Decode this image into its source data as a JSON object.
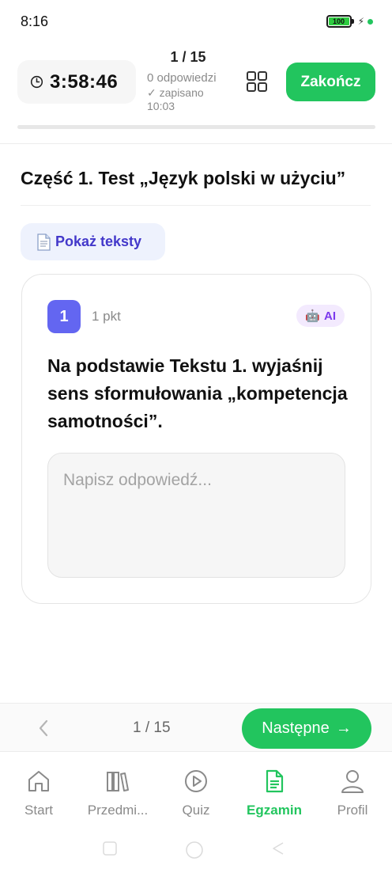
{
  "status_bar": {
    "time": "8:16",
    "battery_text": "100",
    "battery_level": 1.0
  },
  "header": {
    "timer": "3:58:46",
    "progress": "1 / 15",
    "answers": "0 odpowiedzi",
    "saved": "✓ zapisano",
    "saved_time": "10:03",
    "finish_label": "Zakończ",
    "progress_fraction": 0.0
  },
  "section": {
    "title": "Część 1. Test „Język polski w użyciu”"
  },
  "show_texts": {
    "label": "Pokaż teksty",
    "icon": "document-icon"
  },
  "question": {
    "number": "1",
    "points": "1 pkt",
    "ai_label": "AI",
    "ai_icon": "robot-icon",
    "text": "Na podstawie Tekstu 1. wyjaśnij sens sformułowania „kompetencja samotności”.",
    "answer_placeholder": "Napisz odpowiedź...",
    "answer_value": ""
  },
  "question_nav": {
    "counter": "1 / 15",
    "next_label": "Następne",
    "next_arrow": "→"
  },
  "tabs": [
    {
      "label": "Start",
      "icon": "home-icon",
      "active": false
    },
    {
      "label": "Przedmi...",
      "icon": "books-icon",
      "active": false
    },
    {
      "label": "Quiz",
      "icon": "play-icon",
      "active": false
    },
    {
      "label": "Egzamin",
      "icon": "document-icon",
      "active": true
    },
    {
      "label": "Profil",
      "icon": "user-icon",
      "active": false
    }
  ],
  "colors": {
    "accent_green": "#22c55e",
    "question_badge": "#6366f1",
    "show_texts_text": "#4338ca",
    "ai_text": "#7c3aed"
  }
}
